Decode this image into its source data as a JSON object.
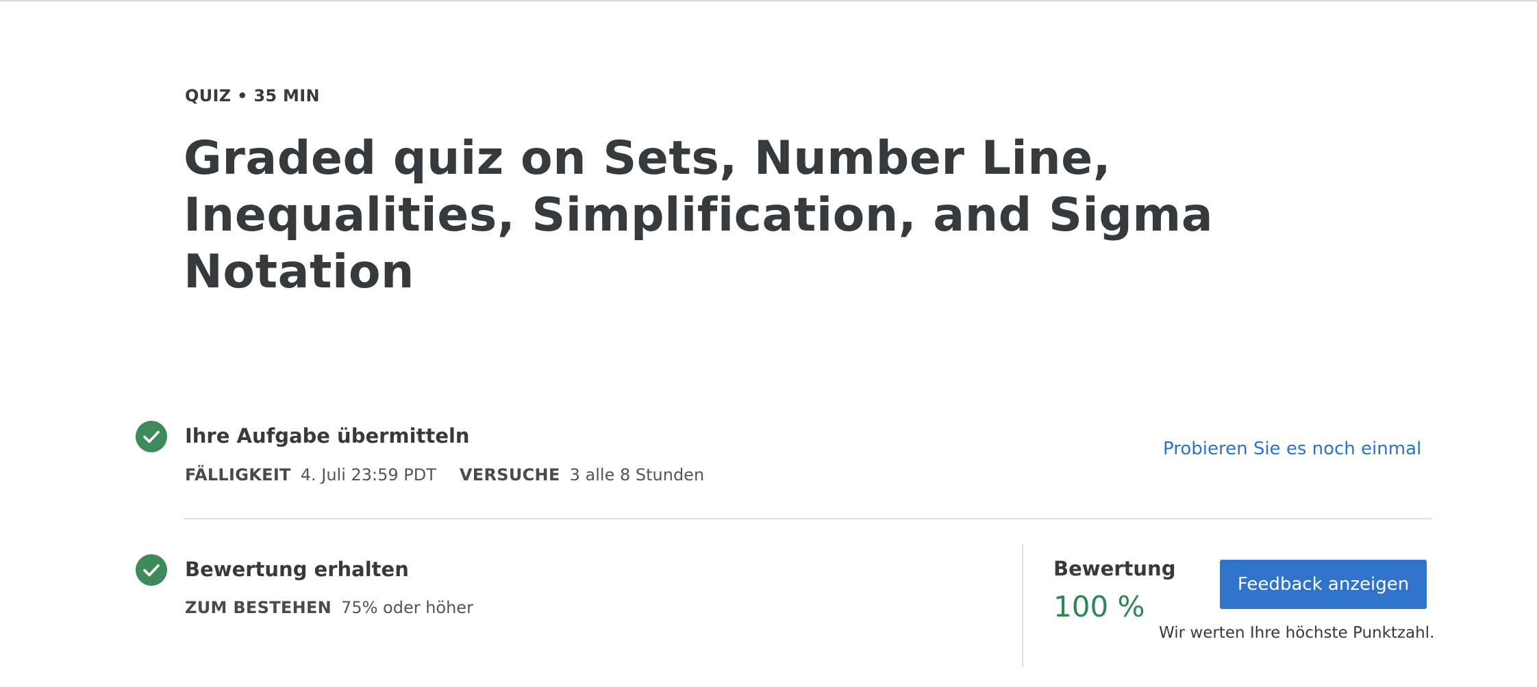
{
  "header": {
    "eyebrow": "QUIZ • 35 MIN",
    "title": "Graded quiz on Sets, Number Line, Inequalities, Simplification, and Sigma Notation"
  },
  "submit_step": {
    "title": "Ihre Aufgabe übermitteln",
    "due_label": "FÄLLIGKEIT",
    "due_value": "4. Juli 23:59 PDT",
    "attempts_label": "VERSUCHE",
    "attempts_value": "3 alle 8 Stunden",
    "retry_link": "Probieren Sie es noch einmal"
  },
  "grade_step": {
    "title": "Bewertung erhalten",
    "pass_label": "ZUM BESTEHEN",
    "pass_value": "75% oder höher",
    "grade_label": "Bewertung",
    "grade_value": "100 %",
    "feedback_button": "Feedback anzeigen",
    "note": "Wir werten Ihre höchste Punktzahl."
  },
  "colors": {
    "check_green": "#3e8a5b",
    "grade_green": "#2e8555",
    "link_blue": "#2a73cc",
    "button_blue": "#2f73cb",
    "text_dark": "#373a3c"
  },
  "icons": {
    "completed": "check-circle-icon"
  }
}
